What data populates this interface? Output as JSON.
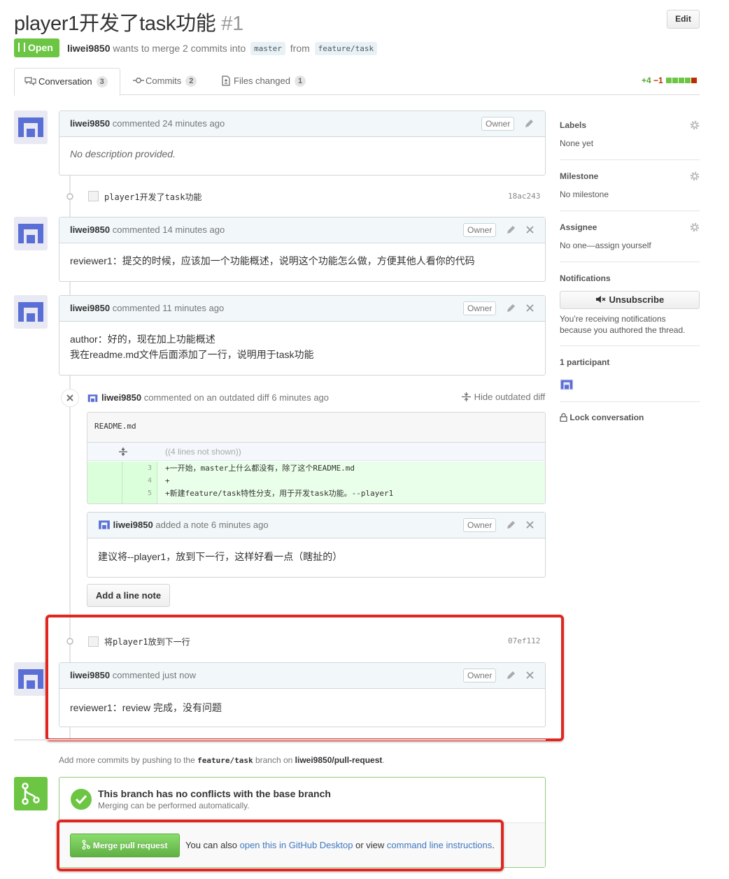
{
  "pr": {
    "title": "player1开发了task功能",
    "number": "#1",
    "edit_label": "Edit",
    "state": "Open",
    "author": "liwei9850",
    "merge_text": "wants to merge 2 commits into",
    "base": "master",
    "from_text": "from",
    "head": "feature/task"
  },
  "tabs": [
    {
      "label": "Conversation",
      "count": "3"
    },
    {
      "label": "Commits",
      "count": "2"
    },
    {
      "label": "Files changed",
      "count": "1"
    }
  ],
  "diffstat": {
    "added": "+4",
    "removed": "−1",
    "bar_colors": [
      "#6cc644",
      "#6cc644",
      "#6cc644",
      "#6cc644",
      "#bd2c00"
    ]
  },
  "owner_label": "Owner",
  "comments": [
    {
      "author": "liwei9850",
      "action": "commented",
      "time": "24 minutes ago",
      "body": "No description provided."
    },
    {
      "author": "liwei9850",
      "action": "commented",
      "time": "14 minutes ago",
      "body": "reviewer1：提交的时候，应该加一个功能概述，说明这个功能怎么做，方便其他人看你的代码"
    },
    {
      "author": "liwei9850",
      "action": "commented",
      "time": "11 minutes ago",
      "body_lines": [
        "author：好的，现在加上功能概述",
        "我在readme.md文件后面添加了一行，说明用于task功能"
      ]
    },
    {
      "author": "liwei9850",
      "action": "commented",
      "time": "just now",
      "body": "reviewer1：review 完成，没有问题"
    }
  ],
  "commits": [
    {
      "message": "player1开发了task功能",
      "sha": "18ac243"
    },
    {
      "message": "将player1放到下一行",
      "sha": "07ef112"
    }
  ],
  "outdated": {
    "author": "liwei9850",
    "text": "commented on an outdated diff 6 minutes ago",
    "hide_label": "Hide outdated diff",
    "file": "README.md",
    "hidden_lines": "((4 lines not shown))",
    "lines": [
      {
        "num": "3",
        "code": "+一开始，master上什么都没有，除了这个README.md"
      },
      {
        "num": "4",
        "code": "+"
      },
      {
        "num": "5",
        "code": "+新建feature/task特性分支，用于开发task功能。--player1"
      }
    ],
    "note": {
      "author": "liwei9850",
      "action": "added a note",
      "time": "6 minutes ago",
      "body": "建议将--player1，放到下一行，这样好看一点（瞎扯的）"
    },
    "add_note_label": "Add a line note"
  },
  "sidebar": {
    "labels_h": "Labels",
    "labels_v": "None yet",
    "milestone_h": "Milestone",
    "milestone_v": "No milestone",
    "assignee_h": "Assignee",
    "assignee_v": "No one—assign yourself",
    "notifications_h": "Notifications",
    "unsubscribe": "Unsubscribe",
    "notif_line1": "You’re receiving notifications",
    "notif_line2": "because you authored the thread.",
    "participants_h": "1 participant",
    "lock": "Lock conversation"
  },
  "footer": {
    "add_more_pre": "Add more commits by pushing to the",
    "add_more_branch": "feature/task",
    "add_more_mid": "branch on",
    "add_more_repo": "liwei9850/pull-request",
    "add_more_end": ".",
    "merge_title": "This branch has no conflicts with the base branch",
    "merge_sub": "Merging can be performed automatically.",
    "merge_btn": "Merge pull request",
    "also_text": "You can also",
    "desktop_link": "open this in GitHub Desktop",
    "or_view": "or view",
    "cli_link": "command line instructions",
    "end": "."
  },
  "colors": {
    "green": "#6cc644",
    "link": "#4078c0",
    "highlight_red": "#e0261e",
    "diff_add_bg": "#eaffea"
  }
}
